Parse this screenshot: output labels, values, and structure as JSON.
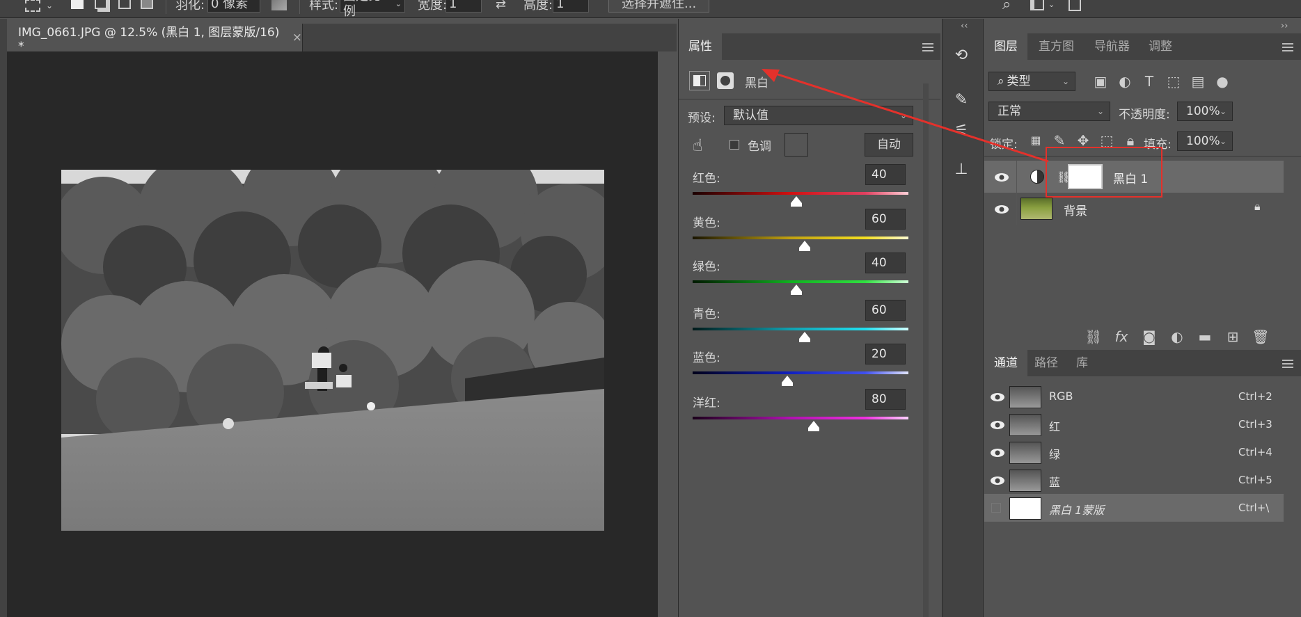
{
  "options_bar": {
    "feather_label": "羽化:",
    "feather_value": "0 像素",
    "style_label": "样式:",
    "style_value": "固定比例",
    "width_label": "宽度:",
    "width_value": "1",
    "height_label": "高度:",
    "height_value": "1",
    "select_mask_button": "选择并遮住..."
  },
  "document": {
    "tab_title": "IMG_0661.JPG @ 12.5% (黑白 1, 图层蒙版/16) *",
    "close_glyph": "×"
  },
  "properties": {
    "tab_label": "属性",
    "adjustment_name": "黑白",
    "preset_label": "预设:",
    "preset_value": "默认值",
    "tint_label": "色调",
    "auto_button": "自动",
    "sliders": [
      {
        "label": "红色:",
        "value": "40",
        "level": 0.48,
        "gradient": "linear-gradient(90deg,#1a0000,#d01010 45%,#e04060 80%,#ffd0d8)"
      },
      {
        "label": "黄色:",
        "value": "60",
        "level": 0.52,
        "gradient": "linear-gradient(90deg,#1a1500,#c0a010 45%,#f5e020 80%,#fffbd0)"
      },
      {
        "label": "绿色:",
        "value": "40",
        "level": 0.48,
        "gradient": "linear-gradient(90deg,#001a00,#10b020 45%,#30e040 80%,#d0ffd8)"
      },
      {
        "label": "青色:",
        "value": "60",
        "level": 0.52,
        "gradient": "linear-gradient(90deg,#001a1a,#10a0b0 45%,#20e0f0 80%,#d0ffff)"
      },
      {
        "label": "蓝色:",
        "value": "20",
        "level": 0.44,
        "gradient": "linear-gradient(90deg,#00001a,#1020c0 45%,#4050f0 80%,#e0e4ff)"
      },
      {
        "label": "洋红:",
        "value": "80",
        "level": 0.56,
        "gradient": "linear-gradient(90deg,#1a001a,#b010b0 45%,#f030e0 80%,#ffd0ff)"
      }
    ]
  },
  "layers_panel": {
    "tabs": [
      "图层",
      "直方图",
      "导航器",
      "调整"
    ],
    "filter_label": "类型",
    "blend_mode": "正常",
    "opacity_label": "不透明度:",
    "opacity_value": "100%",
    "lock_label": "锁定:",
    "fill_label": "填充:",
    "fill_value": "100%",
    "layers": [
      {
        "name": "黑白 1"
      },
      {
        "name": "背景"
      }
    ]
  },
  "channels_panel": {
    "tabs": [
      "通道",
      "路径",
      "库"
    ],
    "channels": [
      {
        "name": "RGB",
        "shortcut": "Ctrl+2"
      },
      {
        "name": "红",
        "shortcut": "Ctrl+3"
      },
      {
        "name": "绿",
        "shortcut": "Ctrl+4"
      },
      {
        "name": "蓝",
        "shortcut": "Ctrl+5"
      },
      {
        "name": "黑白 1蒙版",
        "shortcut": "Ctrl+\\"
      }
    ]
  },
  "colors": {
    "annotation_red": "#e4312b",
    "panel_bg": "#535353",
    "panel_dark": "#424242",
    "canvas_bg": "#282828"
  }
}
